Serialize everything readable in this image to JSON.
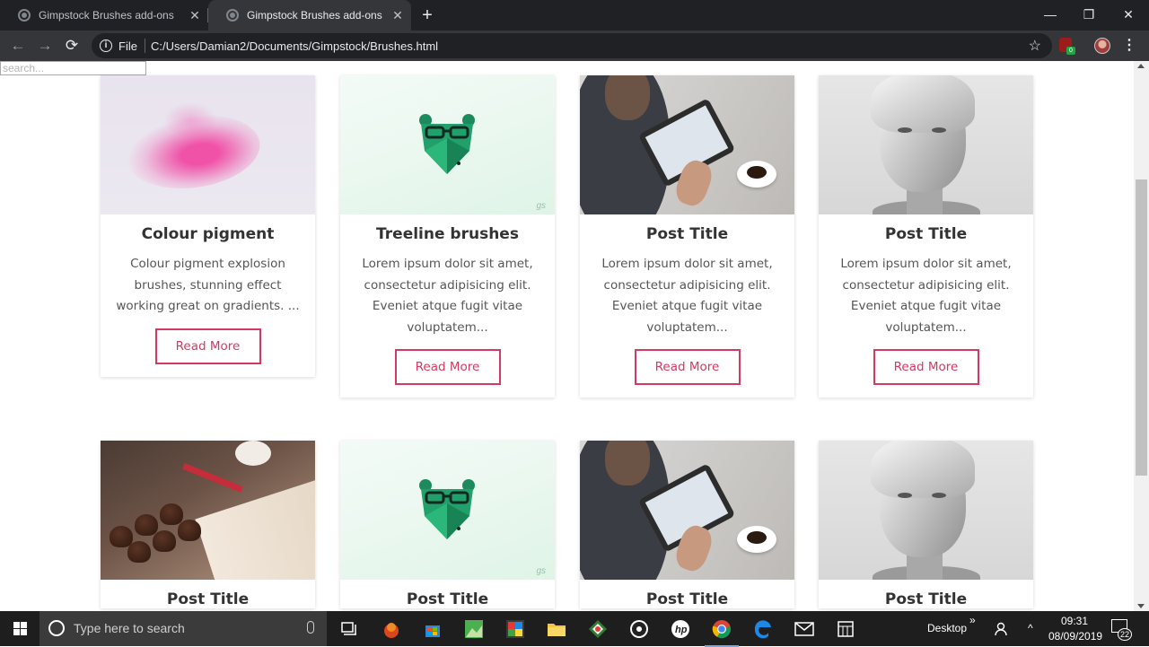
{
  "browser": {
    "tabs": [
      {
        "title": "Gimpstock Brushes add-ons",
        "active": false
      },
      {
        "title": "Gimpstock Brushes add-ons",
        "active": true
      }
    ],
    "new_tab_symbol": "+",
    "window_controls": {
      "minimize": "—",
      "restore": "❐",
      "close": "✕"
    },
    "toolbar": {
      "back": "←",
      "forward": "→",
      "reload": "⟳",
      "info": "i",
      "scheme_label": "File",
      "url": "C:/Users/Damian2/Documents/Gimpstock/Brushes.html",
      "bookmark": "☆",
      "extension_badge": "0",
      "menu": "⋮"
    }
  },
  "page": {
    "search": {
      "placeholder": "search..."
    },
    "accent_color": "#d33a61",
    "cards": [
      {
        "title": "Colour pigment",
        "description": "Colour pigment explosion brushes, stunning effect working great on gradients. ...",
        "button": "Read More",
        "image": "pink-pigment"
      },
      {
        "title": "Treeline brushes",
        "description": "Lorem ipsum dolor sit amet, consectetur adipisicing elit. Eveniet atque fugit vitae voluptatem...",
        "button": "Read More",
        "image": "green-bear"
      },
      {
        "title": "Post Title",
        "description": "Lorem ipsum dolor sit amet, consectetur adipisicing elit. Eveniet atque fugit vitae voluptatem...",
        "button": "Read More",
        "image": "tablet-coffee"
      },
      {
        "title": "Post Title",
        "description": "Lorem ipsum dolor sit amet, consectetur adipisicing elit. Eveniet atque fugit vitae voluptatem...",
        "button": "Read More",
        "image": "polygon-statue"
      },
      {
        "title": "Post Title",
        "image": "muffins-book"
      },
      {
        "title": "Post Title",
        "image": "green-bear"
      },
      {
        "title": "Post Title",
        "image": "tablet-coffee"
      },
      {
        "title": "Post Title",
        "image": "polygon-statue"
      }
    ],
    "bear_signature": "gs"
  },
  "taskbar": {
    "search_placeholder": "Type here to search",
    "desktop_label": "Desktop",
    "time": "09:31",
    "date": "08/09/2019",
    "notification_count": "22",
    "chevron": "»",
    "tray_up": "^"
  }
}
